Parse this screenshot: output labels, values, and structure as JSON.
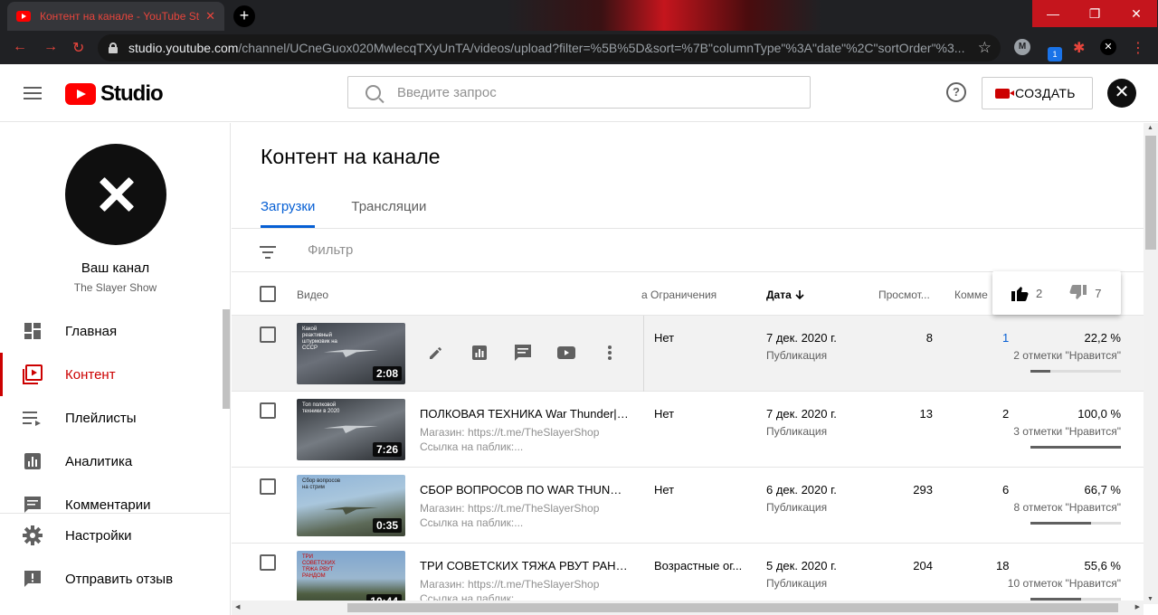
{
  "browser": {
    "tab_title": "Контент на канале - YouTube Studio",
    "tab_close": "✕",
    "new_tab": "+",
    "url_domain": "studio.youtube.com",
    "url_path": "/channel/UCneGuox020MwlecqTXyUnTA/videos/upload?filter=%5B%5D&sort=%7B\"columnType\"%3A\"date\"%2C\"sortOrder\"%3...",
    "ext_badge": "1",
    "ext_avatar": "M"
  },
  "header": {
    "logo_text": "Studio",
    "search_placeholder": "Введите запрос",
    "create_label": "СОЗДАТЬ",
    "help": "?",
    "avatar": "✕"
  },
  "sidebar": {
    "channel_name": "Ваш канал",
    "channel_sub": "The Slayer Show",
    "items": [
      {
        "label": "Главная"
      },
      {
        "label": "Контент"
      },
      {
        "label": "Плейлисты"
      },
      {
        "label": "Аналитика"
      },
      {
        "label": "Комментарии"
      }
    ],
    "bottom": [
      {
        "label": "Настройки"
      },
      {
        "label": "Отправить отзыв"
      }
    ]
  },
  "main": {
    "title": "Контент на канале",
    "tabs": [
      "Загрузки",
      "Трансляции"
    ],
    "filter_label": "Фильтр",
    "columns": {
      "video": "Видео",
      "restrictions": "а Ограничения",
      "date": "Дата",
      "views": "Просмот...",
      "comments": "Комме"
    },
    "rows": [
      {
        "cap": "Какой реактивный штурмовик на СССР",
        "duration": "2:08",
        "title": "",
        "desc1": "",
        "desc2": "",
        "restriction": "Нет",
        "date": "7 дек. 2020 г.",
        "status": "Публикация",
        "views": "8",
        "comments": "1",
        "percent": "22,2 %",
        "likes_text": "2 отметки \"Нравится\"",
        "ratio": 22.2
      },
      {
        "cap": "Топ полковой техники в 2020",
        "duration": "7:26",
        "title": "ПОЛКОВАЯ ТЕХНИКА War Thunder| ...",
        "desc1": "Магазин: https://t.me/TheSlayerShop",
        "desc2": "Ссылка на паблик:...",
        "restriction": "Нет",
        "date": "7 дек. 2020 г.",
        "status": "Публикация",
        "views": "13",
        "comments": "2",
        "percent": "100,0 %",
        "likes_text": "3 отметки \"Нравится\"",
        "ratio": 100
      },
      {
        "cap": "Сбор вопросов на стрим",
        "duration": "0:35",
        "title": "СБОР ВОПРОСОВ ПО WAR THUNDER...",
        "desc1": "Магазин: https://t.me/TheSlayerShop",
        "desc2": "Ссылка на паблик:...",
        "restriction": "Нет",
        "date": "6 дек. 2020 г.",
        "status": "Публикация",
        "views": "293",
        "comments": "6",
        "percent": "66,7 %",
        "likes_text": "8 отметок \"Нравится\"",
        "ratio": 66.7
      },
      {
        "cap": "ТРИ СОВЕТСКИХ ТЯЖА РВУТ РАНДОМ",
        "duration": "10:44",
        "title": "ТРИ СОВЕТСКИХ ТЯЖА РВУТ РАНД...",
        "desc1": "Магазин: https://t.me/TheSlayerShop",
        "desc2": "Ссылка на паблик:...",
        "restriction": "Возрастные ог...",
        "date": "5 дек. 2020 г.",
        "status": "Публикация",
        "views": "204",
        "comments": "18",
        "percent": "55,6 %",
        "likes_text": "10 отметок \"Нравится\"",
        "ratio": 55.6
      }
    ]
  },
  "tooltip": {
    "likes": "2",
    "dislikes": "7"
  },
  "colors": {
    "accent": "#065fd4",
    "brand": "#ff0000",
    "active": "#cc0000"
  }
}
